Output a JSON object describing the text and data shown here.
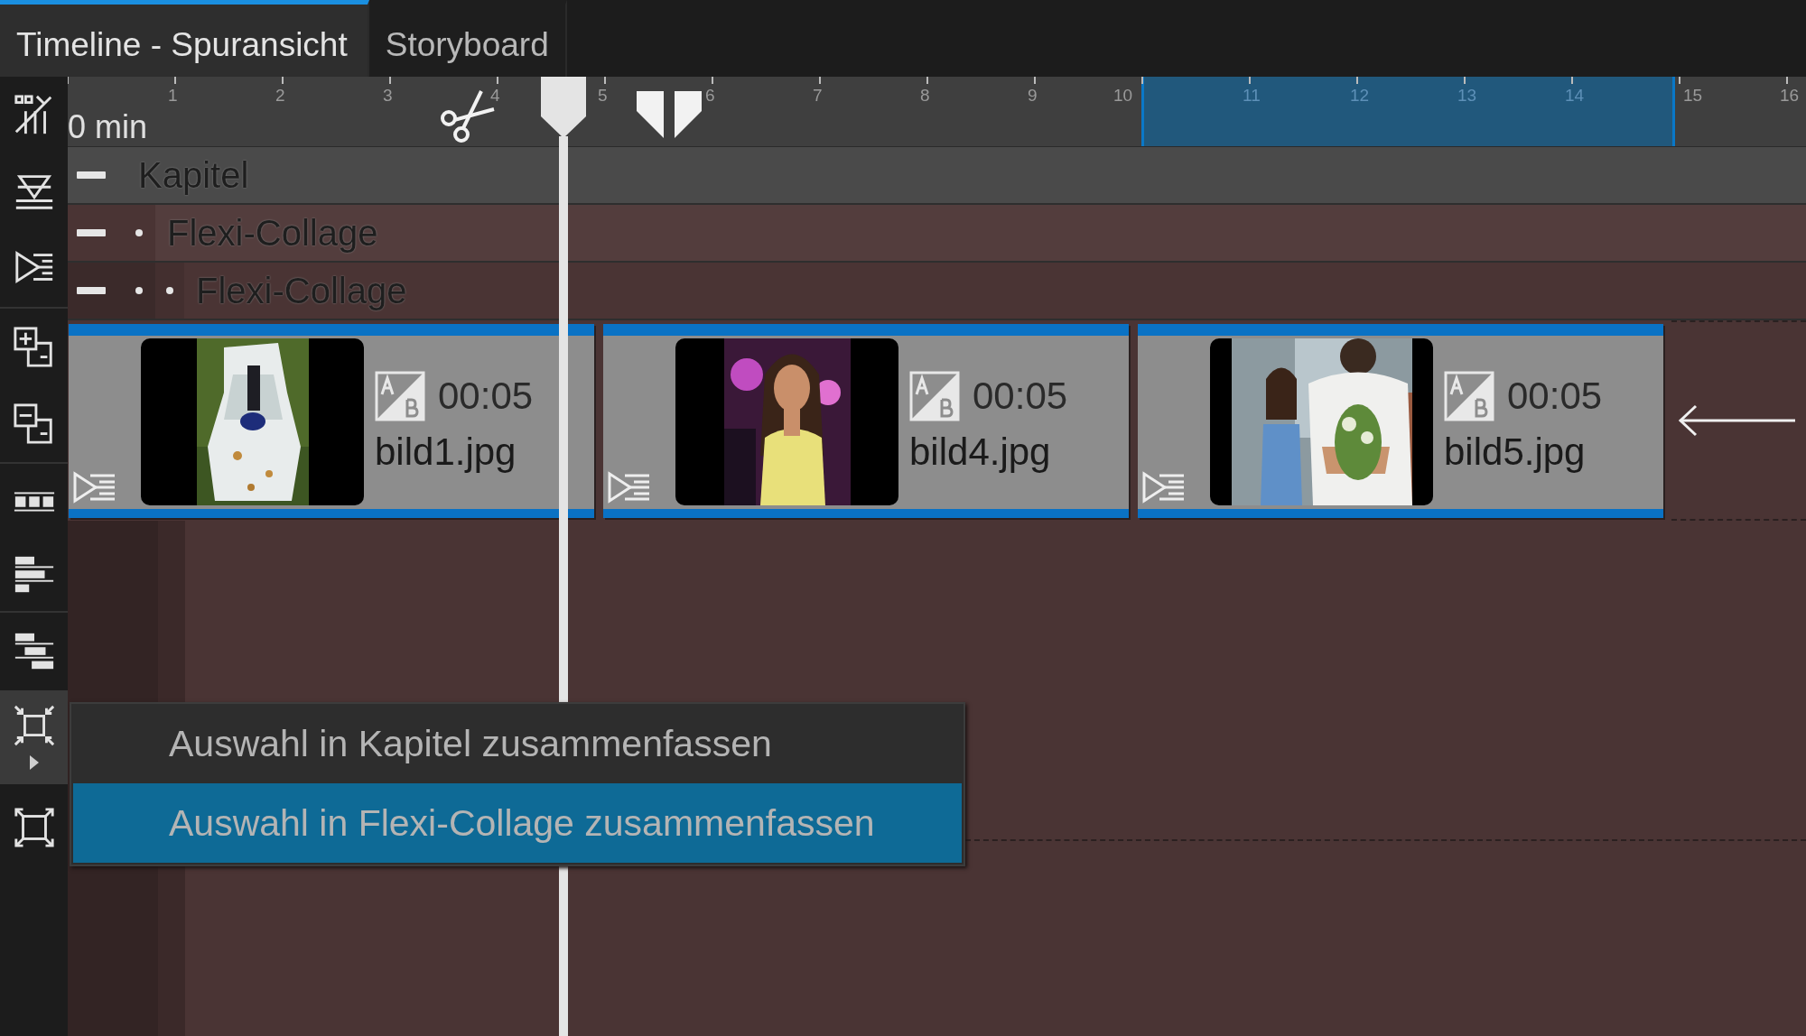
{
  "tabs": [
    {
      "label": "Timeline - Spuransicht",
      "selected": true
    },
    {
      "label": "Storyboard",
      "selected": false
    }
  ],
  "toolbar": [
    {
      "kind": "button",
      "pressed": false
    },
    {
      "kind": "button",
      "pressed": false
    },
    {
      "kind": "button",
      "pressed": false
    },
    {
      "kind": "button",
      "pressed": false
    },
    {
      "kind": "button",
      "pressed": false
    },
    {
      "kind": "button",
      "pressed": false
    },
    {
      "kind": "button",
      "pressed": false
    },
    {
      "kind": "button",
      "pressed": false
    },
    {
      "kind": "menu",
      "pressed": true
    },
    {
      "kind": "button",
      "pressed": false
    }
  ],
  "ruler": {
    "unit_label": "0 min",
    "ticks": [
      "1",
      "2",
      "3",
      "4",
      "5",
      "6",
      "7",
      "8",
      "9",
      "10",
      "11",
      "12",
      "13",
      "14",
      "15",
      "16"
    ]
  },
  "tracks": [
    {
      "label": "Kapitel",
      "expanded": true,
      "children": [
        {
          "label": "Flexi-Collage",
          "expanded": true,
          "children": [
            {
              "label": "Flexi-Collage",
              "expanded": true,
              "clips": [
                {
                  "duration": "00:05",
                  "filename": "bild1.jpg",
                  "selected": true
                },
                {
                  "duration": "00:05",
                  "filename": "bild4.jpg",
                  "selected": true
                },
                {
                  "duration": "00:05",
                  "filename": "bild5.jpg",
                  "selected": true
                }
              ]
            }
          ]
        }
      ]
    }
  ],
  "context_menu": {
    "items": [
      {
        "label": "Auswahl in Kapitel zusammenfassen",
        "selected": false
      },
      {
        "label": "Auswahl in Flexi-Collage zusammenfassen",
        "selected": true
      }
    ]
  }
}
